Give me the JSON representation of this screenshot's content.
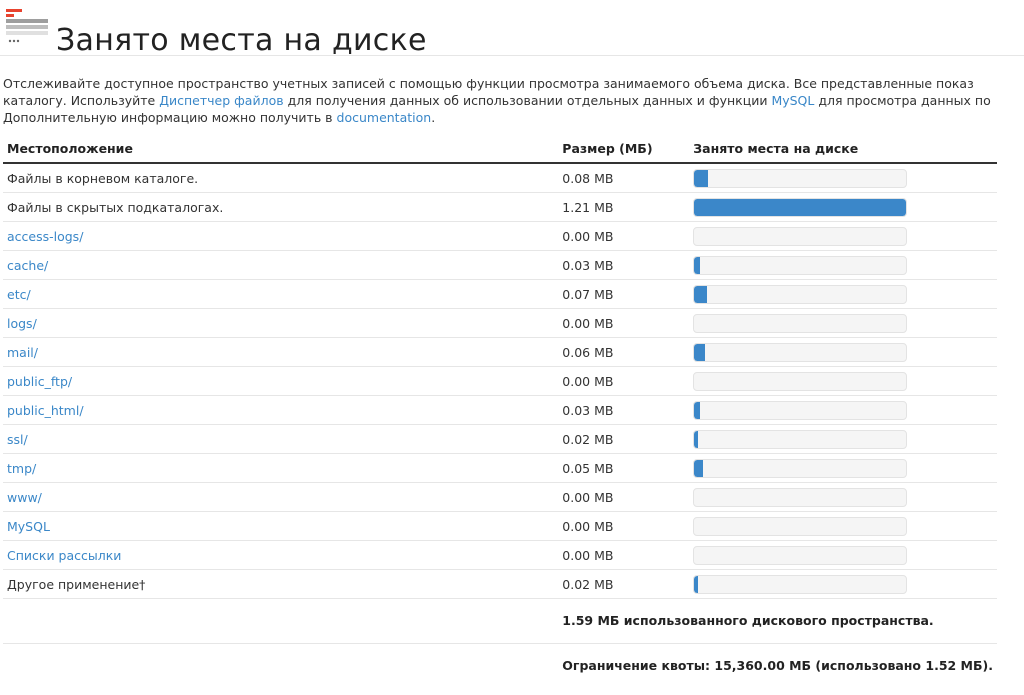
{
  "header": {
    "title": "Занято места на диске",
    "icon": "disk-usage-icon"
  },
  "description": {
    "line1_text": "Отслеживайте доступное пространство учетных записей с помощью функции просмотра занимаемого объема диска. Все представленные показ",
    "line2_a": "каталогу. Используйте ",
    "line2_link1": "Диспетчер файлов",
    "line2_b": " для получения данных об использовании отдельных данных и функции ",
    "line2_link2": "MySQL",
    "line2_c": " для просмотра данных по",
    "line3_a": "Дополнительную информацию можно получить в ",
    "line3_link": "documentation",
    "line3_b": "."
  },
  "table": {
    "headers": {
      "location": "Местоположение",
      "size": "Размер (МБ)",
      "usage": "Занято места на диске"
    },
    "rows": [
      {
        "location": "Файлы в корневом каталоге.",
        "link": false,
        "size": "0.08 MB",
        "fraction": 0.066
      },
      {
        "location": "Файлы в скрытых подкаталогах.",
        "link": false,
        "size": "1.21 MB",
        "fraction": 1.0
      },
      {
        "location": "access-logs/",
        "link": true,
        "size": "0.00 MB",
        "fraction": 0
      },
      {
        "location": "cache/",
        "link": true,
        "size": "0.03 MB",
        "fraction": 0.025
      },
      {
        "location": "etc/",
        "link": true,
        "size": "0.07 MB",
        "fraction": 0.058
      },
      {
        "location": "logs/",
        "link": true,
        "size": "0.00 MB",
        "fraction": 0
      },
      {
        "location": "mail/",
        "link": true,
        "size": "0.06 MB",
        "fraction": 0.05
      },
      {
        "location": "public_ftp/",
        "link": true,
        "size": "0.00 MB",
        "fraction": 0
      },
      {
        "location": "public_html/",
        "link": true,
        "size": "0.03 MB",
        "fraction": 0.025
      },
      {
        "location": "ssl/",
        "link": true,
        "size": "0.02 MB",
        "fraction": 0.017
      },
      {
        "location": "tmp/",
        "link": true,
        "size": "0.05 MB",
        "fraction": 0.041
      },
      {
        "location": "www/",
        "link": true,
        "size": "0.00 MB",
        "fraction": 0
      },
      {
        "location": "MySQL",
        "link": true,
        "size": "0.00 MB",
        "fraction": 0
      },
      {
        "location": "Списки рассылки",
        "link": true,
        "size": "0.00 MB",
        "fraction": 0
      },
      {
        "location": "Другое применение†",
        "link": false,
        "size": "0.02 MB",
        "fraction": 0.017
      }
    ],
    "summary_used": "1.59 МБ использованного дискового пространства.",
    "summary_quota": "Ограничение квоты: 15,360.00 МБ (использовано 1.52 МБ)."
  },
  "colors": {
    "accent": "#3b87c9",
    "link": "#3a87c8"
  }
}
